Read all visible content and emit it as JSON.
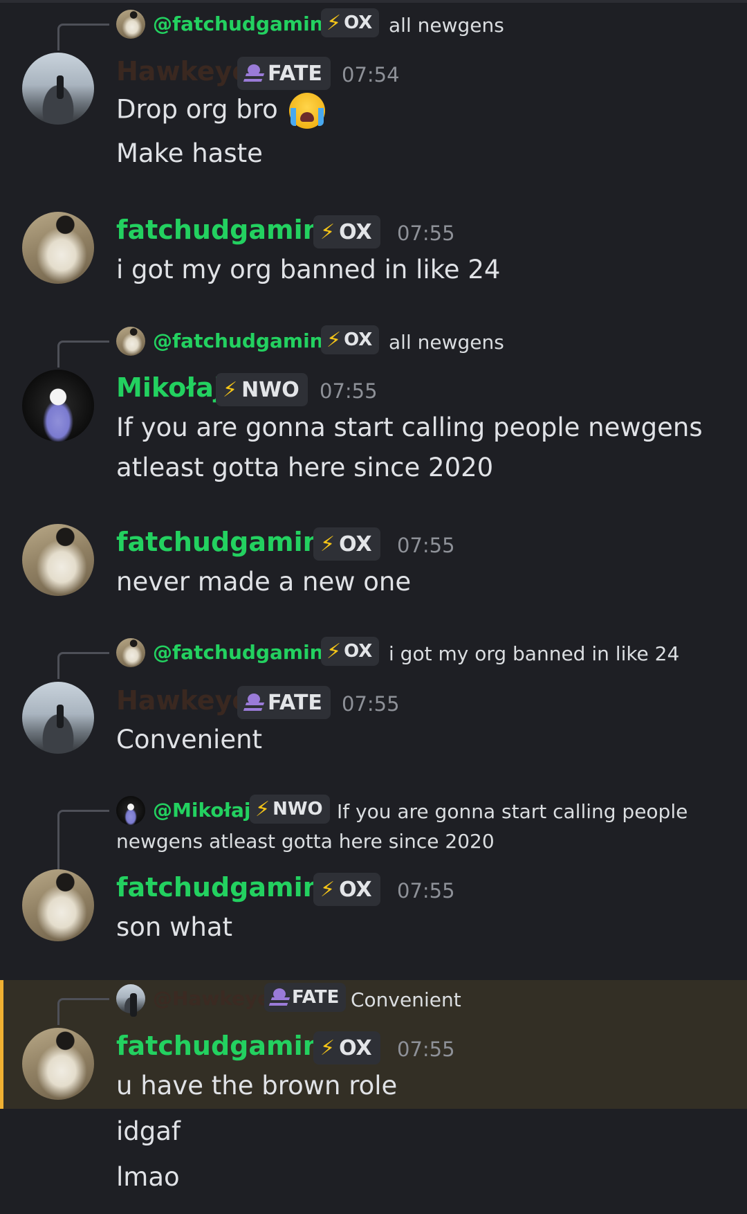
{
  "messages": [
    {
      "reply": {
        "user": "@fatchudgaming",
        "tag": "OX",
        "text": "all newgens"
      },
      "user": "Hawkeye",
      "tag": "FATE",
      "time": "07:54",
      "lines": [
        "Drop org bro",
        "Make haste"
      ]
    },
    {
      "user": "fatchudgaming",
      "tag": "OX",
      "time": "07:55",
      "lines": [
        "i got my org banned in like 24"
      ]
    },
    {
      "reply": {
        "user": "@fatchudgaming",
        "tag": "OX",
        "text": "all newgens"
      },
      "user": "Mikołaj",
      "tag": "NWO",
      "time": "07:55",
      "lines": [
        "If you are gonna start calling people newgens",
        "atleast gotta here since 2020"
      ]
    },
    {
      "user": "fatchudgaming",
      "tag": "OX",
      "time": "07:55",
      "lines": [
        "never made a new one"
      ]
    },
    {
      "reply": {
        "user": "@fatchudgaming",
        "tag": "OX",
        "text": "i got my org banned in like 24"
      },
      "user": "Hawkeye",
      "tag": "FATE",
      "time": "07:55",
      "lines": [
        "Convenient"
      ]
    },
    {
      "reply": {
        "user": "@Mikołaj",
        "tag": "NWO",
        "text": "If you are gonna start calling people",
        "text2": "newgens atleast gotta here since 2020"
      },
      "user": "fatchudgaming",
      "tag": "OX",
      "time": "07:55",
      "lines": [
        "son what"
      ]
    },
    {
      "reply": {
        "user": "@Hawkeye",
        "tag": "FATE",
        "text": "Convenient"
      },
      "user": "fatchudgaming",
      "tag": "OX",
      "time": "07:55",
      "lines": [
        "u have the brown role",
        "idgaf",
        "lmao"
      ]
    }
  ],
  "colors": {
    "background": "#1e1f24",
    "ox_user": "#23d160",
    "brown_role": "#3a2820",
    "mention_highlight": "#332f25",
    "mention_bar": "#f0b132"
  },
  "icons": [
    "lightning-bolt-icon",
    "skull-icon",
    "loudly-crying-emoji"
  ]
}
